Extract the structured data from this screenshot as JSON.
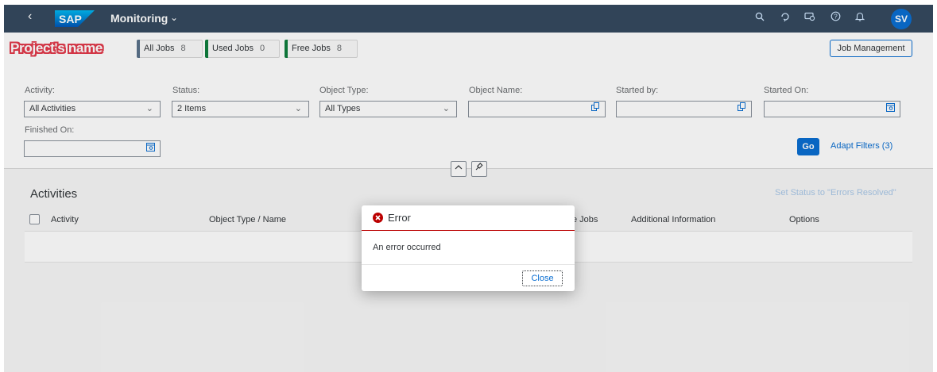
{
  "shell": {
    "back_icon": "chevron-left-icon",
    "logo_text": "SAP",
    "app_title": "Monitoring",
    "icons": [
      "search-icon",
      "refresh-icon",
      "notification-settings-icon",
      "help-icon",
      "bell-icon"
    ],
    "user_initials": "SV"
  },
  "header": {
    "project_name": "Project's name",
    "kpis": [
      {
        "label": "All Jobs",
        "value": "8",
        "color": "#5b738b"
      },
      {
        "label": "Used Jobs",
        "value": "0",
        "color": "#107e3e"
      },
      {
        "label": "Free Jobs",
        "value": "8",
        "color": "#107e3e"
      }
    ],
    "job_management_label": "Job Management"
  },
  "filters": {
    "activity": {
      "label": "Activity:",
      "value": "All Activities"
    },
    "status": {
      "label": "Status:",
      "value": "2 Items"
    },
    "object_type": {
      "label": "Object Type:",
      "value": "All Types"
    },
    "object_name": {
      "label": "Object Name:",
      "value": ""
    },
    "started_by": {
      "label": "Started by:",
      "value": ""
    },
    "started_on": {
      "label": "Started On:",
      "value": ""
    },
    "finished_on": {
      "label": "Finished On:",
      "value": ""
    },
    "go_label": "Go",
    "adapt_label": "Adapt Filters (3)"
  },
  "activities": {
    "title": "Activities",
    "set_status_label": "Set Status to \"Errors Resolved\"",
    "columns": [
      "Activity",
      "Object Type / Name",
      "e Jobs",
      "Additional Information",
      "Options"
    ]
  },
  "dialog": {
    "title": "Error",
    "message": "An error occurred",
    "close_label": "Close",
    "error_color": "#bb0000"
  },
  "colors": {
    "shell_bg": "#354a5f",
    "accent": "#0a6ed1"
  }
}
